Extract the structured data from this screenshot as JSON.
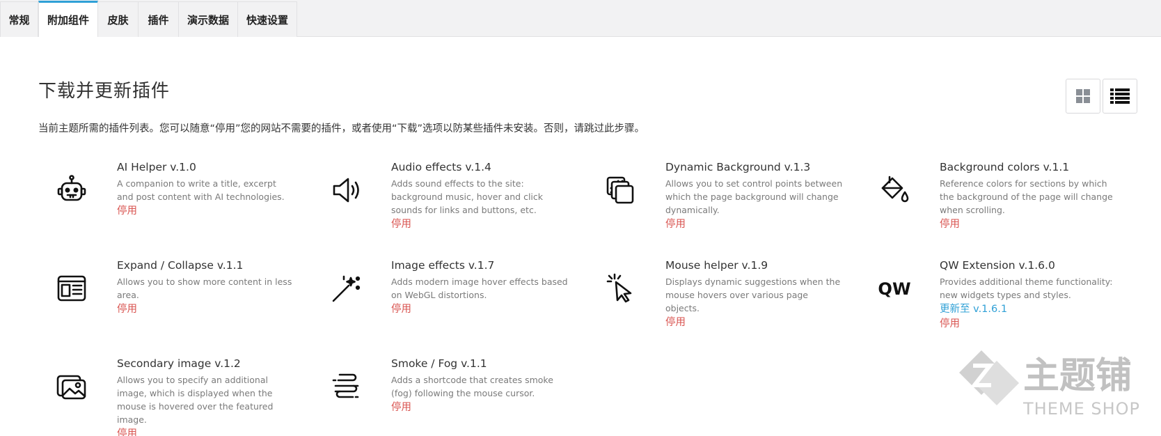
{
  "tabs": [
    {
      "label": "常规",
      "active": false
    },
    {
      "label": "附加组件",
      "active": true
    },
    {
      "label": "皮肤",
      "active": false
    },
    {
      "label": "插件",
      "active": false
    },
    {
      "label": "演示数据",
      "active": false
    },
    {
      "label": "快速设置",
      "active": false
    }
  ],
  "page": {
    "title": "下载并更新插件",
    "description": "当前主题所需的插件列表。您可以随意“停用”您的网站不需要的插件，或者使用“下载”选项以防某些插件未安装。否则，请跳过此步骤。"
  },
  "view_toggle": {
    "options": [
      "grid-icon",
      "list-icon"
    ],
    "selected": "list-icon"
  },
  "plugins": [
    {
      "name": "AI Helper v.1.0",
      "description": "A companion to write a title, excerpt and post content with AI technologies.",
      "update": "",
      "disable": "停用",
      "icon": "robot-icon"
    },
    {
      "name": "Audio effects v.1.4",
      "description": "Adds sound effects to the site: background music, hover and click sounds for links and buttons, etc.",
      "update": "",
      "disable": "停用",
      "icon": "speaker-icon"
    },
    {
      "name": "Dynamic Background v.1.3",
      "description": "Allows you to set control points between which the page background will change dynamically.",
      "update": "",
      "disable": "停用",
      "icon": "layers-icon"
    },
    {
      "name": "Background colors v.1.1",
      "description": "Reference colors for sections by which the background of the page will change when scrolling.",
      "update": "",
      "disable": "停用",
      "icon": "paint-bucket-icon"
    },
    {
      "name": "Expand / Collapse v.1.1",
      "description": "Allows you to show more content in less area.",
      "update": "",
      "disable": "停用",
      "icon": "article-icon"
    },
    {
      "name": "Image effects v.1.7",
      "description": "Adds modern image hover effects based on WebGL distortions.",
      "update": "",
      "disable": "停用",
      "icon": "magic-wand-icon"
    },
    {
      "name": "Mouse helper v.1.9",
      "description": "Displays dynamic suggestions when the mouse hovers over various page objects.",
      "update": "",
      "disable": "停用",
      "icon": "cursor-click-icon"
    },
    {
      "name": "QW Extension v.1.6.0",
      "description": "Provides additional theme functionality: new widgets types and styles.",
      "update": "更新至 v.1.6.1",
      "disable": "停用",
      "icon": "qw-logo-icon"
    },
    {
      "name": "Secondary image v.1.2",
      "description": "Allows you to specify an additional image, which is displayed when the mouse is hovered over the featured image.",
      "update": "",
      "disable": "停用",
      "icon": "images-icon"
    },
    {
      "name": "Smoke / Fog v.1.1",
      "description": "Adds a shortcode that creates smoke (fog) following the mouse cursor.",
      "update": "",
      "disable": "停用",
      "icon": "fog-icon"
    }
  ],
  "watermark": {
    "brand": "主题铺",
    "tagline": "THEME SHOP"
  },
  "colors": {
    "accent": "#2fa0d6",
    "disable": "#d9534f",
    "muted": "#7a7a7a"
  }
}
